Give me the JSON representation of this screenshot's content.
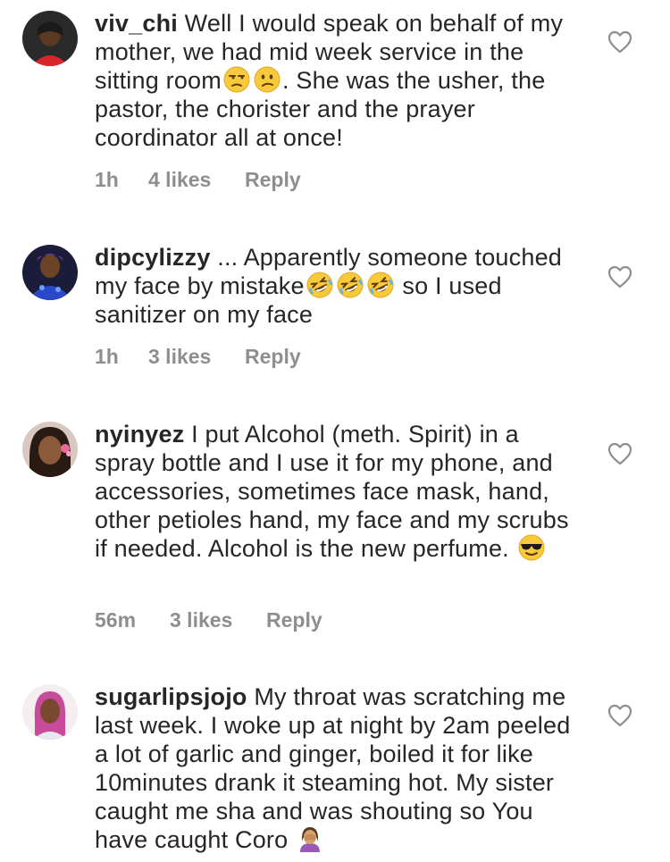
{
  "comments": [
    {
      "username": "viv_chi",
      "text_parts": [
        " Well I would speak on behalf of my mother, we had mid week service in the sitting room",
        ". She was the usher, the pastor, the chorister and the prayer coordinator all at once!"
      ],
      "time": "1h",
      "likes": "4 likes",
      "reply": "Reply",
      "emojis": [
        "unamused-face-icon",
        "confused-face-icon"
      ]
    },
    {
      "username": "dipcylizzy",
      "text_parts": [
        " ... Apparently someone touched my face by mistake",
        " so I used sanitizer on my face"
      ],
      "time": "1h",
      "likes": "3 likes",
      "reply": "Reply",
      "emojis": [
        "rolling-laughing-icon",
        "rolling-laughing-icon",
        "rolling-laughing-icon"
      ]
    },
    {
      "username": "nyinyez",
      "text_parts": [
        " I put Alcohol (meth. Spirit) in a spray bottle and I use it for my phone, and accessories, sometimes face mask, hand, other petioles hand, my face and my scrubs if needed. Alcohol is the new perfume. "
      ],
      "time": "56m",
      "likes": "3 likes",
      "reply": "Reply",
      "emojis": [
        "sunglasses-face-icon"
      ]
    },
    {
      "username": "sugarlipsjojo",
      "text_parts": [
        " My throat was scratching me last week. I woke up at night by 2am peeled a lot of garlic and ginger, boiled it for like 10minutes drank it steaming hot. My sister caught me sha and was shouting so You have caught Coro "
      ],
      "emojis": [
        "woman-facepalming-icon"
      ]
    }
  ],
  "colors": {
    "text": "#262626",
    "meta": "#8e8e8e",
    "heart_outline": "#8e8e8e"
  }
}
